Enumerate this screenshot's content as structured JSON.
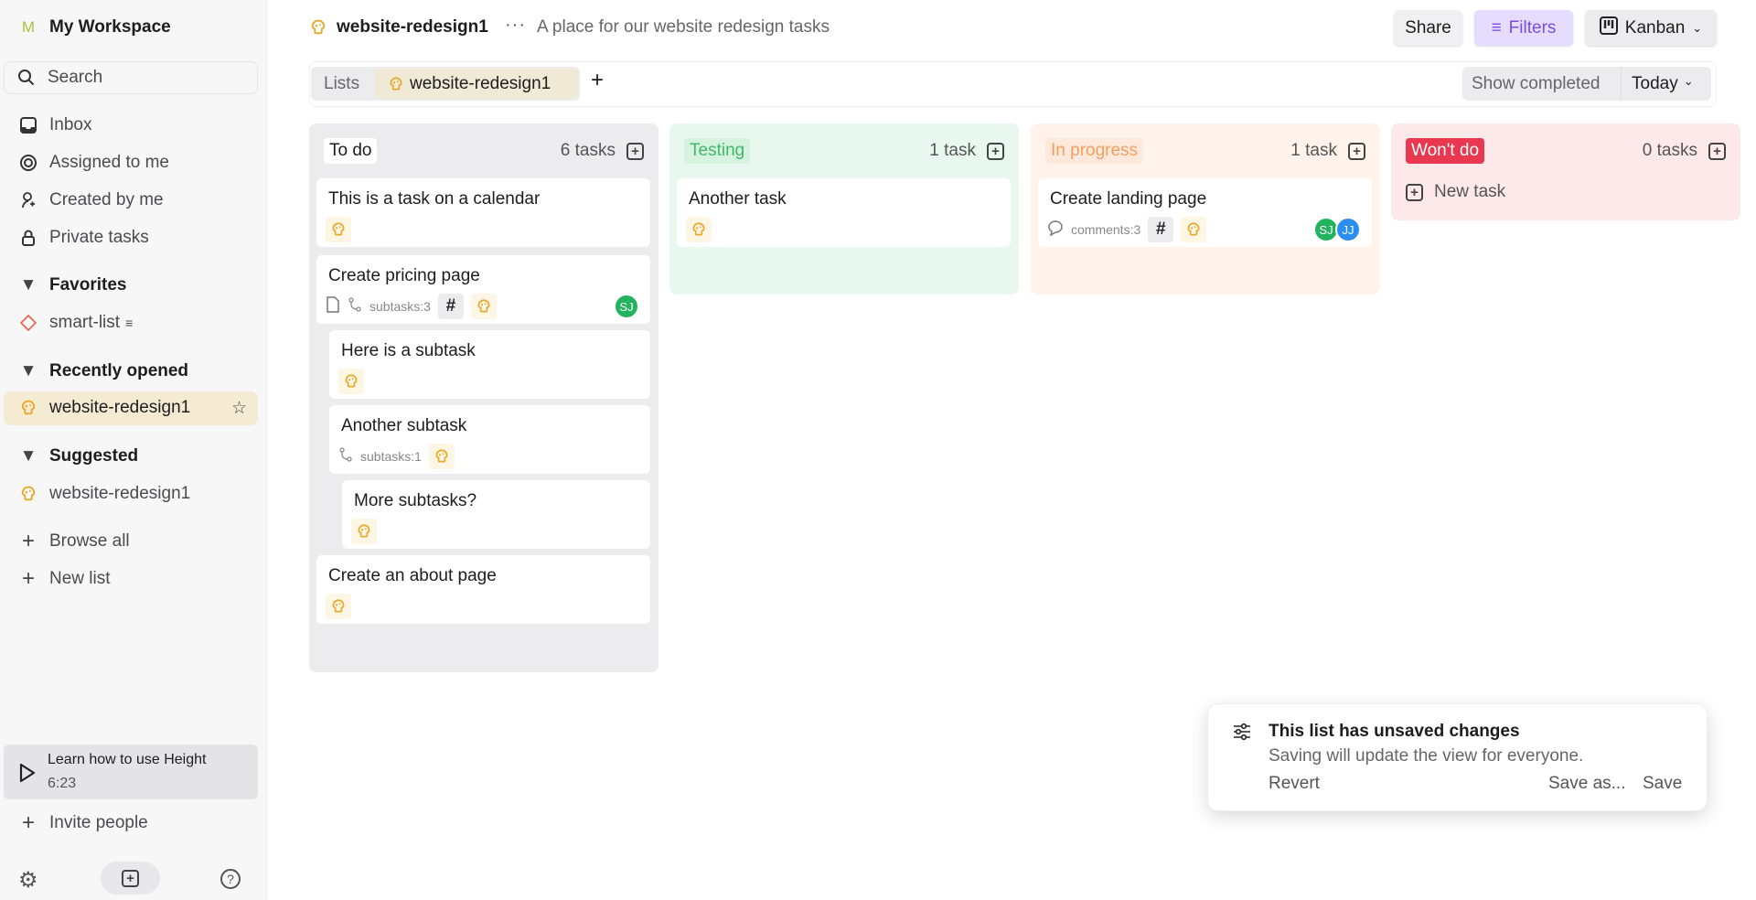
{
  "colors": {
    "accent_filters": "#7b4de8",
    "filters_bg": "#e6dcfd",
    "todo_bg": "#ececee",
    "testing_bg": "#e8f8ee",
    "inprogress_bg": "#fff3ec",
    "wontdo_bg": "#fde8ea",
    "wontdo_label": "#e8374f",
    "avatar_sj": "#22b35e",
    "avatar_jj": "#2a8ef0"
  },
  "sidebar": {
    "workspace_initial": "M",
    "workspace": "My Workspace",
    "search": "Search",
    "nav": [
      {
        "label": "Inbox",
        "icon": "inbox-icon"
      },
      {
        "label": "Assigned to me",
        "icon": "target-icon"
      },
      {
        "label": "Created by me",
        "icon": "user-icon"
      },
      {
        "label": "Private tasks",
        "icon": "lock-icon"
      }
    ],
    "favorites": "Favorites",
    "favorite_item": "smart-list",
    "recent": "Recently opened",
    "recent_item": "website-redesign1",
    "suggested": "Suggested",
    "suggested_item": "website-redesign1",
    "browse_all": "Browse all",
    "new_list": "New list",
    "learn_title": "Learn how to use Height",
    "learn_time": "6:23",
    "invite": "Invite people"
  },
  "header": {
    "title": "website-redesign1",
    "description": "A place for our website redesign tasks",
    "share": "Share",
    "filters": "Filters",
    "view": "Kanban"
  },
  "tabs": {
    "lists": "Lists",
    "active": "website-redesign1",
    "show_completed": "Show completed",
    "date": "Today"
  },
  "columns": [
    {
      "label": "To do",
      "count": "6 tasks"
    },
    {
      "label": "Testing",
      "count": "1 task"
    },
    {
      "label": "In progress",
      "count": "1 task"
    },
    {
      "label": "Won't do",
      "count": "0 tasks",
      "new_task": "New task"
    }
  ],
  "cards": [
    {
      "col": 0,
      "title": "This is a task on a calendar",
      "meta": []
    },
    {
      "col": 0,
      "title": "Create pricing page",
      "meta": [
        "doc",
        "subtasks:3",
        "hash"
      ],
      "avatars": [
        "SJ"
      ]
    },
    {
      "col": 0,
      "title": "Here is a subtask",
      "meta": [],
      "indent": 1
    },
    {
      "col": 0,
      "title": "Another subtask",
      "meta": [
        "subtasks:1"
      ],
      "indent": 1
    },
    {
      "col": 0,
      "title": "More subtasks?",
      "meta": [],
      "indent": 2
    },
    {
      "col": 0,
      "title": "Create an about page",
      "meta": []
    },
    {
      "col": 1,
      "title": "Another task",
      "meta": []
    },
    {
      "col": 2,
      "title": "Create landing page",
      "meta": [
        "comments:3",
        "hash"
      ],
      "avatars": [
        "SJ",
        "JJ"
      ]
    }
  ],
  "toast": {
    "title": "This list has unsaved changes",
    "body": "Saving will update the view for everyone.",
    "revert": "Revert",
    "save_as": "Save as...",
    "save": "Save"
  }
}
